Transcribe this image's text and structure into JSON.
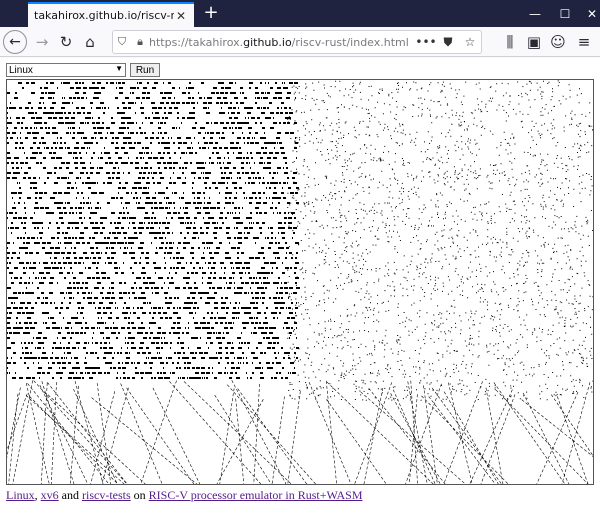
{
  "tab": {
    "title": "takahirox.github.io/riscv-rust/index.h",
    "close": "✕"
  },
  "window": {
    "new_tab": "+",
    "minimize": "—",
    "maximize": "☐",
    "close": "✕"
  },
  "nav": {
    "url_prefix": "https://takahirox.",
    "url_host": "github.io",
    "url_path": "/riscv-rust/index.html",
    "more": "•••"
  },
  "page": {
    "os_select_value": "Linux",
    "run_label": "Run",
    "footer": {
      "link_linux": "Linux",
      "sep1": ", ",
      "link_xv6": "xv6",
      "sep2": " and ",
      "link_tests": "riscv-tests",
      "sep3": " on ",
      "link_emulator": "RISC-V processor emulator in Rust+WASM"
    }
  },
  "colors": {
    "tabstrip": "#202340",
    "accent": "#0a84ff",
    "visited_link": "#551a8b"
  }
}
